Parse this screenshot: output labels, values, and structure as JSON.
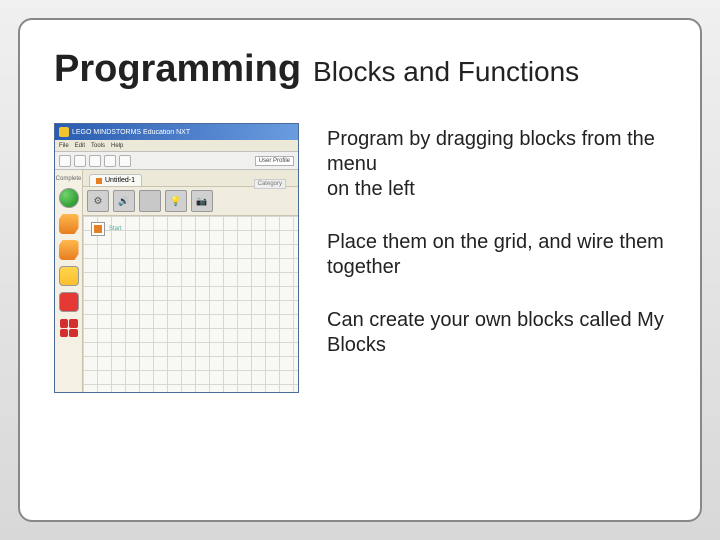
{
  "title": {
    "main": "Programming",
    "sub": "Blocks and Functions"
  },
  "bullets": {
    "p1": "Program by dragging blocks from the menu\non the left",
    "p2": "Place them on the grid, and wire them together",
    "p3": "Can create your own blocks called My Blocks"
  },
  "screenshot": {
    "window_title": "LEGO MINDSTORMS Education NXT",
    "menus": [
      "File",
      "Edit",
      "Tools",
      "Help"
    ],
    "toolbar_right": "User Profile",
    "tab_label": "Untitled-1",
    "palette_label": "Complete",
    "start_label": "Start",
    "category_label": "Category",
    "palette_icons": [
      "green-circle",
      "orange-block",
      "orange-block",
      "yellow-block",
      "red-block",
      "red-multi"
    ],
    "block_row_icons": [
      "gear",
      "sound",
      "display",
      "lamp",
      "camera"
    ]
  }
}
